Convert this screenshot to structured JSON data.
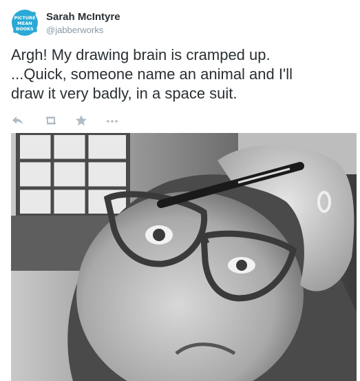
{
  "user": {
    "name": "Sarah McIntyre",
    "handle": "@jabberworks",
    "avatar_text": [
      "PICTURE",
      "MEAN",
      "BOOKS"
    ]
  },
  "tweet": {
    "lines": [
      "Argh! My drawing brain is cramped up.",
      "...Quick, someone name an animal and I'll",
      "draw it very badly, in a space suit."
    ]
  },
  "actions": {
    "icons": [
      "reply-icon",
      "retweet-icon",
      "favorite-icon",
      "more-icon"
    ],
    "icon_color": "#b1bbc3"
  },
  "colors": {
    "name": "#292f33",
    "handle": "#8899a6",
    "avatar_bg": "#2aa9d6"
  }
}
